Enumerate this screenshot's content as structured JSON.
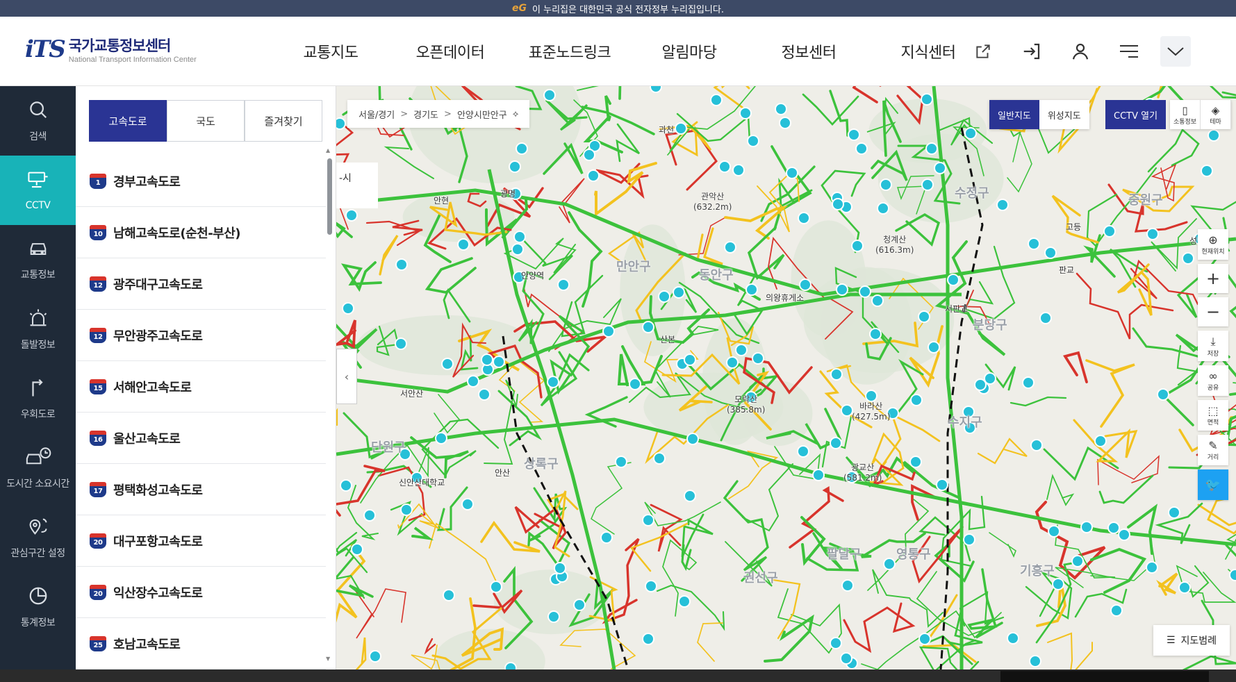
{
  "gov_bar": {
    "logo_text": "eG",
    "notice": "이 누리집은 대한민국 공식 전자정부 누리집입니다."
  },
  "header": {
    "logo_mark": "iTS",
    "logo_ko": "국가교통정보센터",
    "logo_en": "National Transport Information Center",
    "nav": [
      "교통지도",
      "오픈데이터",
      "표준노드링크",
      "알림마당",
      "정보센터",
      "지식센터"
    ]
  },
  "lnb": [
    {
      "label": "검색",
      "icon": "search-icon"
    },
    {
      "label": "CCTV",
      "icon": "cctv-icon"
    },
    {
      "label": "교통정보",
      "icon": "car-icon"
    },
    {
      "label": "돌발정보",
      "icon": "alarm-icon"
    },
    {
      "label": "우회도로",
      "icon": "detour-icon"
    },
    {
      "label": "도시간 소요시간",
      "icon": "car-clock-icon"
    },
    {
      "label": "관심구간 설정",
      "icon": "location-pin-icon"
    },
    {
      "label": "통계정보",
      "icon": "stats-icon"
    }
  ],
  "panel": {
    "tabs": [
      "고속도로",
      "국도",
      "즐겨찾기"
    ],
    "roads": [
      {
        "no": "1",
        "name": "경부고속도로"
      },
      {
        "no": "10",
        "name": "남해고속도로(순천-부산)"
      },
      {
        "no": "12",
        "name": "광주대구고속도로"
      },
      {
        "no": "12",
        "name": "무안광주고속도로"
      },
      {
        "no": "15",
        "name": "서해안고속도로"
      },
      {
        "no": "16",
        "name": "울산고속도로"
      },
      {
        "no": "17",
        "name": "평택화성고속도로"
      },
      {
        "no": "20",
        "name": "대구포항고속도로"
      },
      {
        "no": "20",
        "name": "익산장수고속도로"
      },
      {
        "no": "25",
        "name": "호남고속도로"
      }
    ]
  },
  "map": {
    "breadcrumb": [
      "서울/경기",
      "경기도",
      "안양시만안구"
    ],
    "breadcrumb_arrow": "⟡",
    "side_label": "-시",
    "map_types": [
      "일반지도",
      "위성지도"
    ],
    "cctv_open": "CCTV 열기",
    "small_btns": [
      "소통정보",
      "테마"
    ],
    "tools": [
      "현재위치",
      "저장",
      "공유",
      "면적",
      "거리"
    ],
    "legend": "지도범례",
    "labels": [
      {
        "text": "관악산\n(632.2m)"
      },
      {
        "text": "청계산\n(616.3m)"
      },
      {
        "text": "모락산\n(385.8m)"
      },
      {
        "text": "바라산\n(427.5m)"
      },
      {
        "text": "광교산\n(581.2m)"
      },
      {
        "text": "만안구"
      },
      {
        "text": "동안구"
      },
      {
        "text": "수정구"
      },
      {
        "text": "중원구"
      },
      {
        "text": "수지구"
      },
      {
        "text": "단원구"
      },
      {
        "text": "상록구"
      },
      {
        "text": "팔달구"
      },
      {
        "text": "영통구"
      },
      {
        "text": "권선구"
      },
      {
        "text": "기흥구"
      },
      {
        "text": "분당구"
      },
      {
        "text": "과천"
      },
      {
        "text": "의왕휴게소"
      },
      {
        "text": "안산"
      },
      {
        "text": "신안산대학교"
      },
      {
        "text": "서안산"
      },
      {
        "text": "안양역"
      },
      {
        "text": "산본"
      },
      {
        "text": "판교"
      },
      {
        "text": "서판교"
      },
      {
        "text": "고등"
      },
      {
        "text": "성남"
      },
      {
        "text": "광명"
      },
      {
        "text": "안현"
      }
    ]
  },
  "colors": {
    "accent": "#2a3494",
    "cctv_active": "#18b3b8",
    "lnb_bg": "#1f2a38",
    "road_green": "#3cc23c",
    "road_yellow": "#f3c21f",
    "road_red": "#d8342c",
    "cctv_marker": "#26c0d8"
  }
}
